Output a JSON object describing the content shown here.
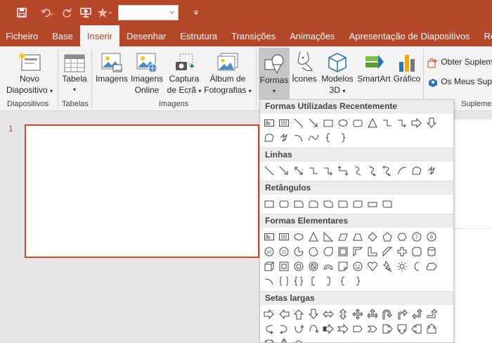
{
  "quick_access": {
    "items": [
      "save-icon",
      "undo-icon",
      "redo-icon",
      "present-icon",
      "star-icon"
    ],
    "box_value": "",
    "customize": "customize-icon"
  },
  "tabs": [
    "Ficheiro",
    "Base",
    "Inserir",
    "Desenhar",
    "Estrutura",
    "Transições",
    "Animações",
    "Apresentação de Diapositivos",
    "Rever"
  ],
  "active_tab": "Inserir",
  "ribbon": {
    "novo_line1": "Novo",
    "novo_line2": "Diapositivo",
    "tabela": "Tabela",
    "imagens": "Imagens",
    "imagens_online_1": "Imagens",
    "imagens_online_2": "Online",
    "captura_1": "Captura",
    "captura_2": "de Ecrã",
    "album_1": "Álbum de",
    "album_2": "Fotografias",
    "formas": "Formas",
    "icones": "Ícones",
    "modelos_1": "Modelos",
    "modelos_2": "3D",
    "smartart": "SmartArt",
    "grafico": "Gráfico",
    "obter": "Obter Suplem",
    "meus": "Os Meus Sup",
    "groups": {
      "diapositivos": "Diapositivos",
      "tabelas": "Tabelas",
      "imagens": "Imagens",
      "suplementos": "Suplemen"
    }
  },
  "slide": {
    "number": "1"
  },
  "accent_color": "#b7472a",
  "dropdown": {
    "sections": [
      {
        "title": "Formas Utilizadas Recentemente",
        "count": 17
      },
      {
        "title": "Linhas",
        "count": 12
      },
      {
        "title": "Retângulos",
        "count": 9
      },
      {
        "title": "Formas Elementares",
        "count": 42
      },
      {
        "title": "Setas largas",
        "count": 30
      }
    ]
  }
}
